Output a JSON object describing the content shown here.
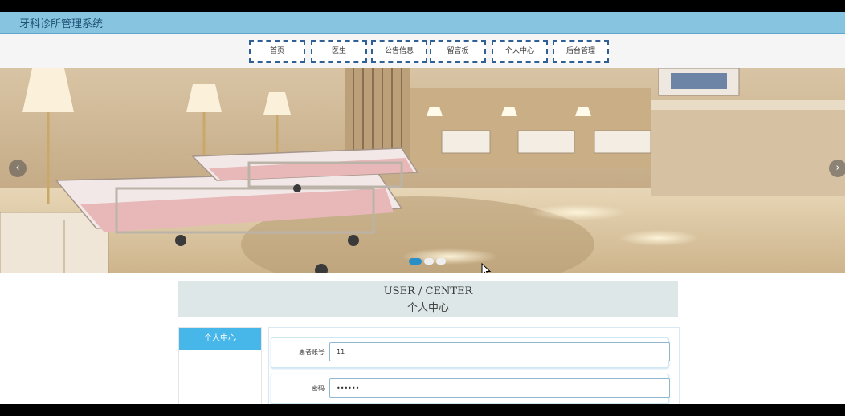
{
  "header": {
    "title": "牙科诊所管理系统"
  },
  "nav": {
    "items": [
      "首页",
      "医生",
      "公告信息",
      "留言板",
      "个人中心",
      "后台管理"
    ]
  },
  "carousel": {
    "prev_icon": "‹",
    "next_icon": "›",
    "slide_count": 3,
    "active_index": 0
  },
  "user_center": {
    "title_en": "USER / CENTER",
    "title_cn": "个人中心"
  },
  "sidebar": {
    "active_item": "个人中心"
  },
  "form": {
    "account_label": "患者账号",
    "account_value": "11",
    "password_label": "密码",
    "password_value": "123456"
  },
  "colors": {
    "title_bar": "#86c4e0",
    "nav_border": "#2f5f94",
    "sidebar_active": "#47b6e8",
    "header_panel": "#dde7e8"
  }
}
